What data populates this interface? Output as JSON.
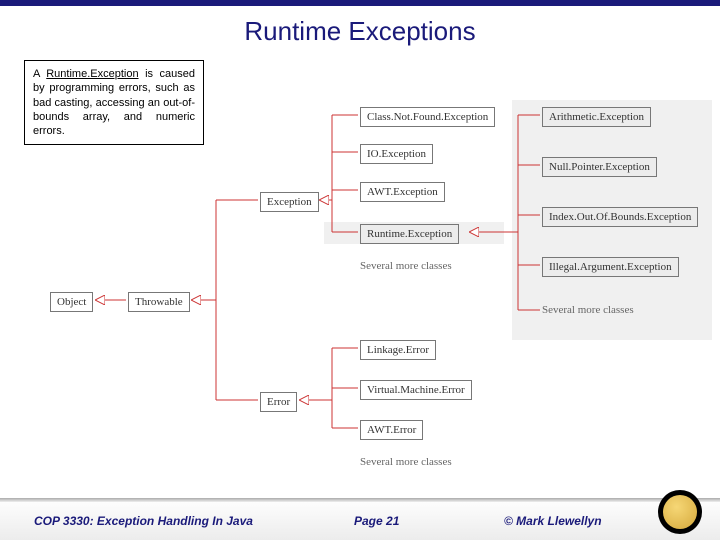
{
  "title": "Runtime Exceptions",
  "callout": {
    "prefix": "A ",
    "term": "Runtime.Exception",
    "rest": " is caused by programming errors, such as bad casting, accessing an out-of-bounds array, and numeric errors."
  },
  "diagram": {
    "root": "Object",
    "throwable": "Throwable",
    "exception": "Exception",
    "error": "Error",
    "exception_children": {
      "cnf": "Class.Not.Found.Exception",
      "io": "IO.Exception",
      "awt": "AWT.Exception",
      "runtime": "Runtime.Exception",
      "more": "Several more classes"
    },
    "runtime_children": {
      "arith": "Arithmetic.Exception",
      "npe": "Null.Pointer.Exception",
      "ioob": "Index.Out.Of.Bounds.Exception",
      "iae": "Illegal.Argument.Exception",
      "more": "Several more classes"
    },
    "error_children": {
      "linkage": "Linkage.Error",
      "vm": "Virtual.Machine.Error",
      "awterr": "AWT.Error",
      "more": "Several more classes"
    }
  },
  "footer": {
    "course": "COP 3330:  Exception Handling In Java",
    "page": "Page 21",
    "copy": "© Mark Llewellyn"
  },
  "chart_data": {
    "type": "tree",
    "title": "Java Throwable class hierarchy (partial)",
    "root": "Object",
    "children": [
      {
        "name": "Throwable",
        "children": [
          {
            "name": "Exception",
            "children": [
              {
                "name": "Class.Not.Found.Exception"
              },
              {
                "name": "IO.Exception"
              },
              {
                "name": "AWT.Exception"
              },
              {
                "name": "Runtime.Exception",
                "highlighted": true,
                "children": [
                  {
                    "name": "Arithmetic.Exception"
                  },
                  {
                    "name": "Null.Pointer.Exception"
                  },
                  {
                    "name": "Index.Out.Of.Bounds.Exception"
                  },
                  {
                    "name": "Illegal.Argument.Exception"
                  },
                  {
                    "name": "Several more classes",
                    "ellipsis": true
                  }
                ]
              },
              {
                "name": "Several more classes",
                "ellipsis": true
              }
            ]
          },
          {
            "name": "Error",
            "children": [
              {
                "name": "Linkage.Error"
              },
              {
                "name": "Virtual.Machine.Error"
              },
              {
                "name": "AWT.Error"
              },
              {
                "name": "Several more classes",
                "ellipsis": true
              }
            ]
          }
        ]
      }
    ]
  }
}
